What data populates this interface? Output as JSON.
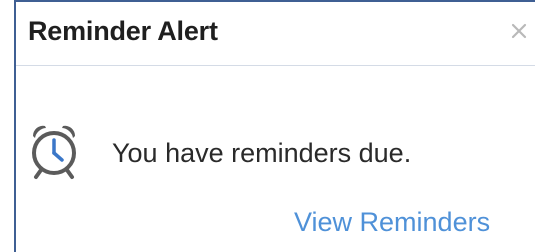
{
  "dialog": {
    "title": "Reminder Alert",
    "close_icon": "close-icon",
    "message": "You have reminders due.",
    "link_label": "View Reminders",
    "icon": "alarm-clock-icon"
  },
  "colors": {
    "border": "#3f5f93",
    "title_text": "#1f1f1f",
    "link": "#4f91d8",
    "icon": "#4a4a4a"
  }
}
